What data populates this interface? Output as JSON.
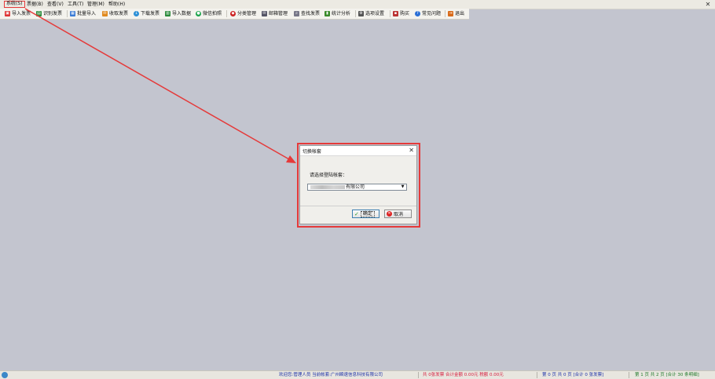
{
  "menu": [
    "系统(S)",
    "票据(B)",
    "查看(V)",
    "工具(T)",
    "管理(M)",
    "帮助(H)"
  ],
  "toolbar": [
    {
      "label": "导入发票",
      "icon": "import-icon",
      "color": "#d33"
    },
    {
      "label": "识别发票",
      "icon": "scan-icon",
      "color": "#2a8a3a"
    },
    {
      "label": "批量导入",
      "icon": "batch-icon",
      "color": "#3a7bd5"
    },
    {
      "label": "收取发票",
      "icon": "receive-icon",
      "color": "#e08a1e"
    },
    {
      "label": "下载发票",
      "icon": "download-icon",
      "color": "#2b8fd6"
    },
    {
      "label": "导入数据",
      "icon": "data-icon",
      "color": "#2a8a3a"
    },
    {
      "label": "微信拍照",
      "icon": "wechat-icon",
      "color": "#19a34a"
    },
    {
      "label": "分类管理",
      "icon": "category-icon",
      "color": "#c22"
    },
    {
      "label": "邮箱管理",
      "icon": "mail-icon",
      "color": "#556"
    },
    {
      "label": "查找发票",
      "icon": "search-icon",
      "color": "#778"
    },
    {
      "label": "统计分析",
      "icon": "chart-icon",
      "color": "#3a8a2a"
    },
    {
      "label": "选项设置",
      "icon": "settings-icon",
      "color": "#555"
    },
    {
      "label": "购买",
      "icon": "cart-icon",
      "color": "#b33"
    },
    {
      "label": "常见问题",
      "icon": "help-icon",
      "color": "#2b6fd6"
    },
    {
      "label": "退出",
      "icon": "exit-icon",
      "color": "#d96b1a"
    }
  ],
  "dialog": {
    "title": "切换帐套",
    "prompt": "请选择登陆帐套：",
    "selected_value": "有限公司",
    "ok_label": "确定",
    "cancel_label": "取消"
  },
  "status": {
    "welcome": "欢迎您:管理人员 当前帐套:广州瞬速信息科技有限公司",
    "totals": "共 0张发票 合计金额 0.00元 税额 0.00元",
    "pages": "第 0 页 共 0 页 [合计 0 张发票]",
    "pages2": "第 1 页 共 2 页 [合计 30 条明细]"
  },
  "colors": {
    "highlight": "#e53a3a",
    "background": "#c3c5cf",
    "status_red": "#d6183a",
    "status_blue": "#1a2fa8",
    "status_green": "#1f7a2a"
  }
}
